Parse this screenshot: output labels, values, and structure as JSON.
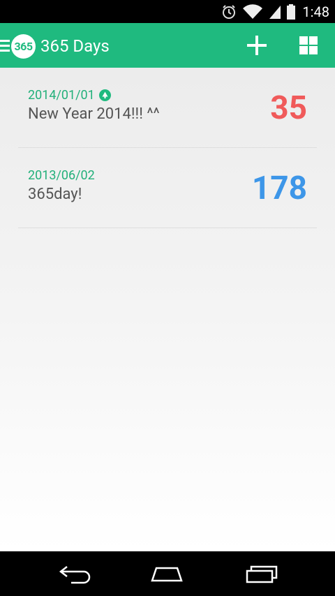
{
  "status_bar": {
    "time": "1:48",
    "icons": [
      "alarm-icon",
      "wifi-icon",
      "signal-icon",
      "battery-icon"
    ]
  },
  "app_bar": {
    "logo_text": "365",
    "title": "365 Days",
    "actions": [
      "add-icon",
      "grid-view-icon"
    ],
    "color": "#1fba7f"
  },
  "events": [
    {
      "date": "2014/01/01",
      "title": "New Year 2014!!! ^^",
      "count": "35",
      "count_color": "#f05a5a",
      "has_badge": true,
      "badge_icon": "tree-icon"
    },
    {
      "date": "2013/06/02",
      "title": "365day!",
      "count": "178",
      "count_color": "#3d96e8",
      "has_badge": false
    }
  ],
  "nav_bar": {
    "buttons": [
      "back-icon",
      "home-icon",
      "recents-icon"
    ]
  }
}
